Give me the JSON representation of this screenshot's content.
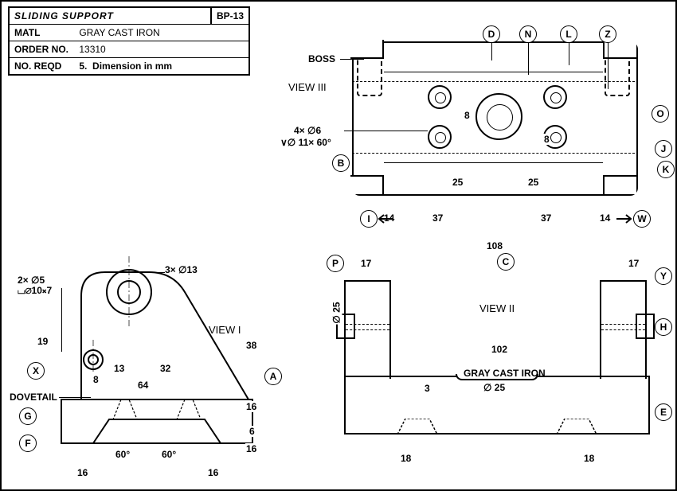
{
  "title_block": {
    "name": "SLIDING SUPPORT",
    "code": "BP-13",
    "matl_label": "MATL",
    "matl": "GRAY CAST IRON",
    "order_label": "ORDER NO.",
    "order": "13310",
    "reqd_label": "NO. REQD",
    "reqd": "5.",
    "dim_note": "Dimension in mm"
  },
  "labels": {
    "boss": "BOSS",
    "dovetail": "DOVETAIL",
    "gray_cast_iron": "GRAY CAST IRON",
    "view1": "VIEW I",
    "view2": "VIEW II",
    "view3": "VIEW III"
  },
  "balloons": {
    "A": "A",
    "B": "B",
    "C": "C",
    "D": "D",
    "E": "E",
    "F": "F",
    "G": "G",
    "H": "H",
    "I": "I",
    "J": "J",
    "K": "K",
    "L": "L",
    "N": "N",
    "O": "O",
    "P": "P",
    "W": "W",
    "X": "X",
    "Y": "Y",
    "Z": "Z"
  },
  "callouts": {
    "holes3x13": "3× ∅13",
    "holes2x5": "2× ∅5",
    "cbore10x7": "⌴∅10⨯7",
    "holes4x6": "4× ∅6",
    "csink11x60": "∨∅ 11× 60°",
    "dia25": "∅ 25",
    "dia25b": "∅ 25"
  },
  "dims": {
    "v3_14L": "14",
    "v3_37L": "37",
    "v3_37R": "37",
    "v3_14R": "14",
    "v3_25L": "25",
    "v3_25R": "25",
    "v3_8t": "8",
    "v3_8b": "8",
    "v2_108": "108",
    "v2_102": "102",
    "v2_17L": "17",
    "v2_17R": "17",
    "v2_3": "3",
    "v2_18L": "18",
    "v2_18R": "18",
    "v1_38": "38",
    "v1_16a": "16",
    "v1_6": "6",
    "v1_16b": "16",
    "v1_19": "19",
    "v1_8": "8",
    "v1_13": "13",
    "v1_32": "32",
    "v1_64": "64",
    "v1_b16L": "16",
    "v1_b16R": "16",
    "v1_60L": "60°",
    "v1_60R": "60°"
  }
}
